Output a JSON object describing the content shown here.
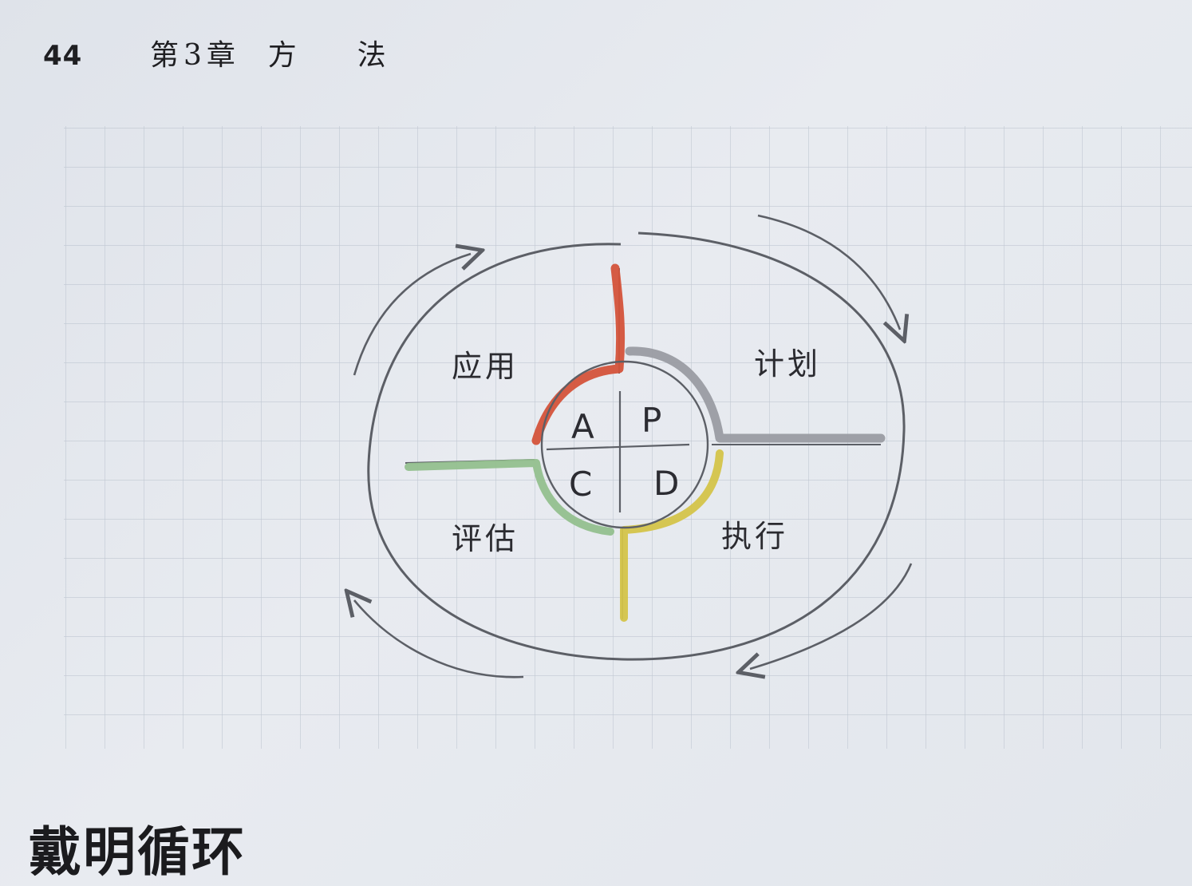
{
  "header": {
    "page_number": "44",
    "chapter_title": "第3章  方    法"
  },
  "diagram": {
    "quadrant_labels": {
      "apply": "应用",
      "plan": "计划",
      "evaluate": "评估",
      "execute": "执行"
    },
    "center_letters": {
      "a": "A",
      "p": "P",
      "c": "C",
      "d": "D"
    },
    "colors": {
      "act": "#d4533a",
      "plan": "#9a9ca2",
      "do": "#d4c449",
      "check": "#93c08e",
      "ink": "#5c5f66",
      "grid": "#b7bfcb"
    }
  },
  "section": {
    "heading": "戴明循环"
  }
}
